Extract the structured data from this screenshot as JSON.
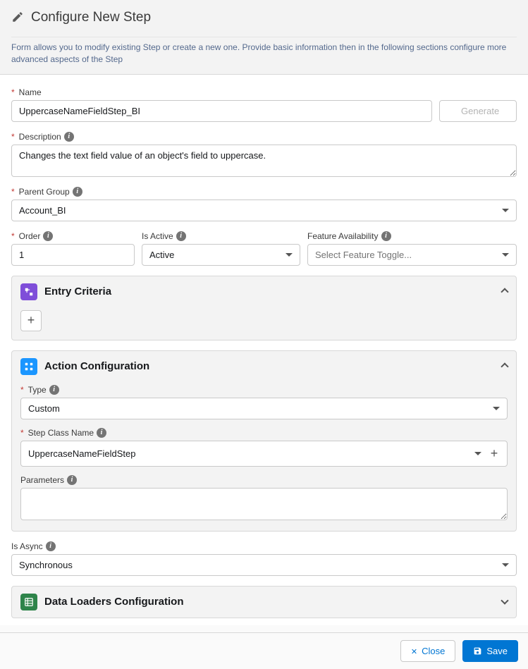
{
  "header": {
    "title": "Configure New Step",
    "subtitle": "Form allows you to modify existing Step or create a new one. Provide basic information then in the following sections configure more advanced aspects of the Step"
  },
  "form": {
    "name": {
      "label": "Name",
      "value": "UppercaseNameFieldStep_BI"
    },
    "generate_btn": "Generate",
    "description": {
      "label": "Description",
      "value": "Changes the text field value of an object's field to uppercase."
    },
    "parent_group": {
      "label": "Parent Group",
      "value": "Account_BI"
    },
    "order": {
      "label": "Order",
      "value": "1"
    },
    "is_active": {
      "label": "Is Active",
      "value": "Active"
    },
    "feature_availability": {
      "label": "Feature Availability",
      "placeholder": "Select Feature Toggle..."
    },
    "is_async": {
      "label": "Is Async",
      "value": "Synchronous"
    }
  },
  "panels": {
    "entry": {
      "title": "Entry Criteria"
    },
    "action": {
      "title": "Action Configuration",
      "type": {
        "label": "Type",
        "value": "Custom"
      },
      "step_class": {
        "label": "Step Class Name",
        "value": "UppercaseNameFieldStep"
      },
      "parameters": {
        "label": "Parameters",
        "value": ""
      }
    },
    "data": {
      "title": "Data Loaders Configuration"
    }
  },
  "footer": {
    "close": "Close",
    "save": "Save"
  }
}
